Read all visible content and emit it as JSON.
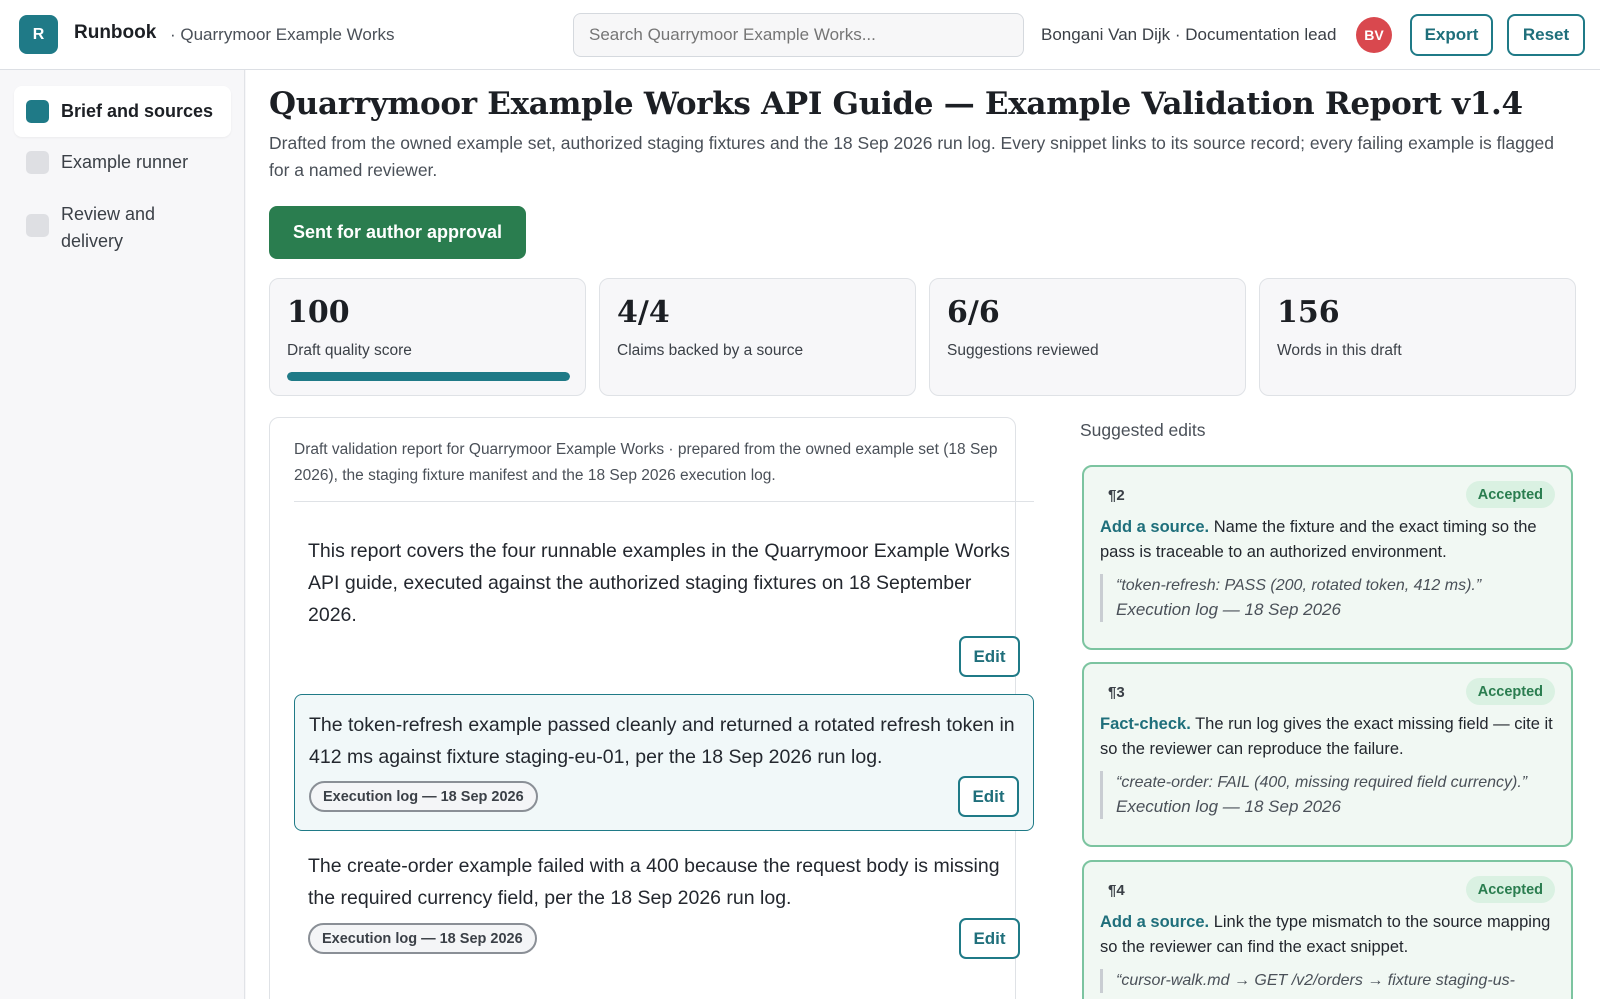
{
  "header": {
    "logo_letter": "R",
    "brand": "Runbook",
    "crumb": "· Quarrymoor Example Works",
    "search_placeholder": "Search Quarrymoor Example Works...",
    "user": "Bongani Van Dijk · Documentation lead",
    "avatar_initials": "BV",
    "export_label": "Export",
    "reset_label": "Reset"
  },
  "sidebar": {
    "items": [
      {
        "label": "Brief and sources",
        "active": true
      },
      {
        "label": "Example runner",
        "active": false
      },
      {
        "label": "Review and delivery",
        "active": false
      }
    ]
  },
  "main": {
    "title": "Quarrymoor Example Works API Guide — Example Validation Report v1.4",
    "subtitle": "Drafted from the owned example set, authorized staging fixtures and the 18 Sep 2026 run log. Every snippet links to its source record; every failing example is flagged for a named reviewer.",
    "status_label": "Sent for author approval",
    "stats": [
      {
        "value": "100",
        "label": "Draft quality score",
        "progress": 100
      },
      {
        "value": "4/4",
        "label": "Claims backed by a source"
      },
      {
        "value": "6/6",
        "label": "Suggestions reviewed"
      },
      {
        "value": "156",
        "label": "Words in this draft"
      }
    ]
  },
  "document": {
    "header": "Draft validation report for Quarrymoor Example Works · prepared from the owned example set (18 Sep 2026), the staging fixture manifest and the 18 Sep 2026 execution log.",
    "edit_label": "Edit",
    "paragraphs": [
      {
        "text": "This report covers the four runnable examples in the Quarrymoor Example Works API guide, executed against the authorized staging fixtures on 18 September 2026."
      },
      {
        "text": "The token-refresh example passed cleanly and returned a rotated refresh token in 412 ms against fixture staging-eu-01, per the 18 Sep 2026 run log.",
        "source": "Execution log — 18 Sep 2026"
      },
      {
        "text": "The create-order example failed with a 400 because the request body is missing the required currency field, per the 18 Sep 2026 run log.",
        "source": "Execution log — 18 Sep 2026"
      }
    ]
  },
  "suggestions": {
    "title": "Suggested edits",
    "cards": [
      {
        "para": "¶2",
        "status": "Accepted",
        "kind": "Add a source.",
        "text": " Name the fixture and the exact timing so the pass is traceable to an authorized environment.",
        "quote": "“token-refresh: PASS (200, rotated token, 412 ms).”",
        "quote_source": "Execution log — 18 Sep 2026"
      },
      {
        "para": "¶3",
        "status": "Accepted",
        "kind": "Fact-check.",
        "text": " The run log gives the exact missing field — cite it so the reviewer can reproduce the failure.",
        "quote": "“create-order: FAIL (400, missing required field currency).”",
        "quote_source": "Execution log — 18 Sep 2026"
      },
      {
        "para": "¶4",
        "status": "Accepted",
        "kind": "Add a source.",
        "text": " Link the type mismatch to the source mapping so the reviewer can find the exact snippet.",
        "quote": "“cursor-walk.md → GET /v2/orders → fixture staging-us-"
      }
    ]
  }
}
